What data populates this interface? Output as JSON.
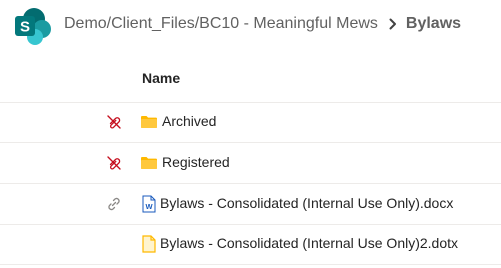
{
  "breadcrumb": {
    "path": "Demo/Client_Files/BC10 - Meaningful Mews",
    "current": "Bylaws"
  },
  "table": {
    "column_name": "Name",
    "rows": [
      {
        "name": "Archived",
        "type": "folder",
        "status_icon": "sync-error-icon"
      },
      {
        "name": "Registered",
        "type": "folder",
        "status_icon": "sync-error-icon"
      },
      {
        "name": "Bylaws - Consolidated (Internal Use Only).docx",
        "type": "word-document",
        "status_icon": "link-icon"
      },
      {
        "name": "Bylaws - Consolidated (Internal Use Only)2.dotx",
        "type": "document-template",
        "status_icon": ""
      }
    ]
  },
  "colors": {
    "brand": "#038387",
    "folder": "#FFB900",
    "word": "#185ABD",
    "error": "#C50F1F"
  }
}
